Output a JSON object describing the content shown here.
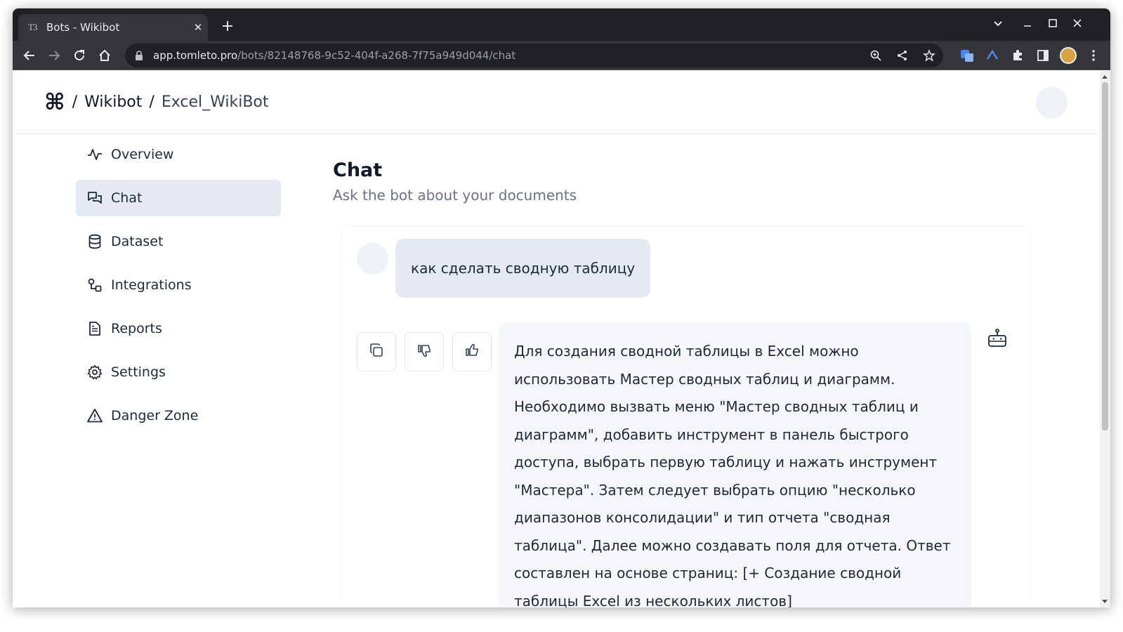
{
  "browser": {
    "tab_title": "Bots - Wikibot",
    "tab_favicon_text": "T3",
    "url_host": "app.tomleto.pro",
    "url_path": "/bots/82148768-9c52-404f-a268-7f75a949d044/chat"
  },
  "header": {
    "logo": "⌘",
    "separator": "/",
    "crumb_1": "Wikibot",
    "crumb_2": "Excel_WikiBot"
  },
  "sidebar": {
    "items": [
      {
        "label": "Overview",
        "icon": "activity-icon",
        "active": false
      },
      {
        "label": "Chat",
        "icon": "chat-icon",
        "active": true
      },
      {
        "label": "Dataset",
        "icon": "database-icon",
        "active": false
      },
      {
        "label": "Integrations",
        "icon": "integrations-icon",
        "active": false
      },
      {
        "label": "Reports",
        "icon": "report-icon",
        "active": false
      },
      {
        "label": "Settings",
        "icon": "gear-icon",
        "active": false
      },
      {
        "label": "Danger Zone",
        "icon": "warning-icon",
        "active": false
      }
    ]
  },
  "main": {
    "title": "Chat",
    "subtitle": "Ask the bot about your documents"
  },
  "chat": {
    "user_message": "как сделать сводную таблицу",
    "bot_message": "Для создания сводной таблицы в Excel можно использовать Мастер сводных таблиц и диаграмм. Необходимо вызвать меню \"Мастер сводных таблиц и диаграмм\", добавить инструмент в панель быстрого доступа, выбрать первую таблицу и нажать инструмент \"Мастера\". Затем следует выбрать опцию \"несколько диапазонов консолидации\" и тип отчета \"сводная таблица\". Далее можно создавать поля для отчета. Ответ составлен на основе страниц: [+ Создание сводной таблицы Excel из нескольких листов](https://exceltable.com/svodnye-"
  },
  "colors": {
    "chrome_dark": "#202124",
    "chrome_toolbar": "#35363a",
    "active_nav_bg": "#e5e9f1",
    "bot_bubble_bg": "#f5f6f9"
  }
}
